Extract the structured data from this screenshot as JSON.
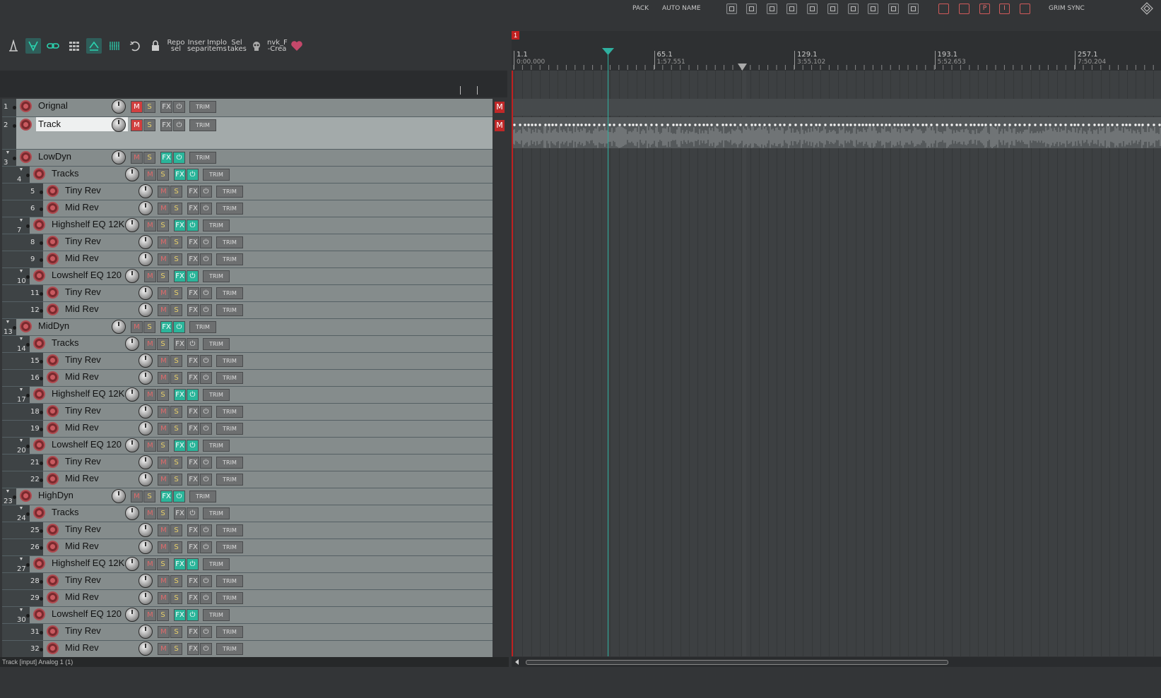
{
  "topbar": {
    "labels": [
      "PACK",
      "AUTO NAME"
    ],
    "grim_sync": "GRIM SYNC",
    "red_buttons": [
      "",
      "",
      "P",
      "I",
      ""
    ]
  },
  "toolbar": {
    "actions": [
      {
        "label": "Repo\nsel"
      },
      {
        "label": "Inser\nsepar"
      },
      {
        "label": "Implo\nitems"
      },
      {
        "label": "Sel\ntakes"
      },
      {
        "label": "nvk_F\n-Crea"
      }
    ],
    "accent": "#2bb59a"
  },
  "ruler": {
    "marker": "1",
    "marks": [
      {
        "bar": "1.1",
        "time": "0:00.000"
      },
      {
        "bar": "65.1",
        "time": "1:57.551"
      },
      {
        "bar": "129.1",
        "time": "3:55.102"
      },
      {
        "bar": "193.1",
        "time": "5:52.653"
      },
      {
        "bar": "257.1",
        "time": "7:50.204"
      }
    ]
  },
  "tracks": [
    {
      "num": "1",
      "name": "Orignal",
      "depth": 0,
      "mute": true,
      "fx": false,
      "folder": false,
      "badge": "M"
    },
    {
      "num": "2",
      "name": "Track",
      "depth": 0,
      "mute": true,
      "fx": false,
      "folder": false,
      "selected": true,
      "badge": "M"
    },
    {
      "num": "3",
      "name": "LowDyn",
      "depth": 0,
      "mute": false,
      "fx": true,
      "folder": true
    },
    {
      "num": "4",
      "name": "Tracks",
      "depth": 1,
      "mute": false,
      "fx": true,
      "folder": true
    },
    {
      "num": "5",
      "name": "Tiny Rev",
      "depth": 2,
      "mute": false,
      "fx": false,
      "folder": false
    },
    {
      "num": "6",
      "name": "Mid Rev",
      "depth": 2,
      "mute": false,
      "fx": false,
      "folder": false
    },
    {
      "num": "7",
      "name": "Highshelf EQ 12K",
      "depth": 1,
      "mute": false,
      "fx": true,
      "folder": true
    },
    {
      "num": "8",
      "name": "Tiny Rev",
      "depth": 2,
      "mute": false,
      "fx": false,
      "folder": false
    },
    {
      "num": "9",
      "name": "Mid Rev",
      "depth": 2,
      "mute": false,
      "fx": false,
      "folder": false
    },
    {
      "num": "10",
      "name": "Lowshelf EQ 120",
      "depth": 1,
      "mute": false,
      "fx": true,
      "folder": true
    },
    {
      "num": "11",
      "name": "Tiny Rev",
      "depth": 2,
      "mute": false,
      "fx": false,
      "folder": false
    },
    {
      "num": "12",
      "name": "Mid Rev",
      "depth": 2,
      "mute": false,
      "fx": false,
      "folder": false
    },
    {
      "num": "13",
      "name": "MidDyn",
      "depth": 0,
      "mute": false,
      "fx": true,
      "folder": true
    },
    {
      "num": "14",
      "name": "Tracks",
      "depth": 1,
      "mute": false,
      "fx": false,
      "folder": true
    },
    {
      "num": "15",
      "name": "Tiny Rev",
      "depth": 2,
      "mute": false,
      "fx": false,
      "folder": false
    },
    {
      "num": "16",
      "name": "Mid Rev",
      "depth": 2,
      "mute": false,
      "fx": false,
      "folder": false
    },
    {
      "num": "17",
      "name": "Highshelf EQ 12K",
      "depth": 1,
      "mute": false,
      "fx": true,
      "folder": true
    },
    {
      "num": "18",
      "name": "Tiny Rev",
      "depth": 2,
      "mute": false,
      "fx": false,
      "folder": false
    },
    {
      "num": "19",
      "name": "Mid Rev",
      "depth": 2,
      "mute": false,
      "fx": false,
      "folder": false
    },
    {
      "num": "20",
      "name": "Lowshelf EQ 120",
      "depth": 1,
      "mute": false,
      "fx": true,
      "folder": true
    },
    {
      "num": "21",
      "name": "Tiny Rev",
      "depth": 2,
      "mute": false,
      "fx": false,
      "folder": false
    },
    {
      "num": "22",
      "name": "Mid Rev",
      "depth": 2,
      "mute": false,
      "fx": false,
      "folder": false
    },
    {
      "num": "23",
      "name": "HighDyn",
      "depth": 0,
      "mute": false,
      "fx": true,
      "folder": true
    },
    {
      "num": "24",
      "name": "Tracks",
      "depth": 1,
      "mute": false,
      "fx": false,
      "folder": true
    },
    {
      "num": "25",
      "name": "Tiny Rev",
      "depth": 2,
      "mute": false,
      "fx": false,
      "folder": false
    },
    {
      "num": "26",
      "name": "Mid Rev",
      "depth": 2,
      "mute": false,
      "fx": false,
      "folder": false
    },
    {
      "num": "27",
      "name": "Highshelf EQ 12K",
      "depth": 1,
      "mute": false,
      "fx": true,
      "folder": true
    },
    {
      "num": "28",
      "name": "Tiny Rev",
      "depth": 2,
      "mute": false,
      "fx": false,
      "folder": false
    },
    {
      "num": "29",
      "name": "Mid Rev",
      "depth": 2,
      "mute": false,
      "fx": false,
      "folder": false
    },
    {
      "num": "30",
      "name": "Lowshelf EQ 120",
      "depth": 1,
      "mute": false,
      "fx": true,
      "folder": true
    },
    {
      "num": "31",
      "name": "Tiny Rev",
      "depth": 2,
      "mute": false,
      "fx": false,
      "folder": false
    },
    {
      "num": "32",
      "name": "Mid Rev",
      "depth": 2,
      "mute": false,
      "fx": false,
      "folder": false
    }
  ],
  "button_labels": {
    "mute": "M",
    "solo": "S",
    "fx": "FX",
    "power": "⏻",
    "trim": "TRIM"
  },
  "status": "Track [input] Analog 1 (1)"
}
